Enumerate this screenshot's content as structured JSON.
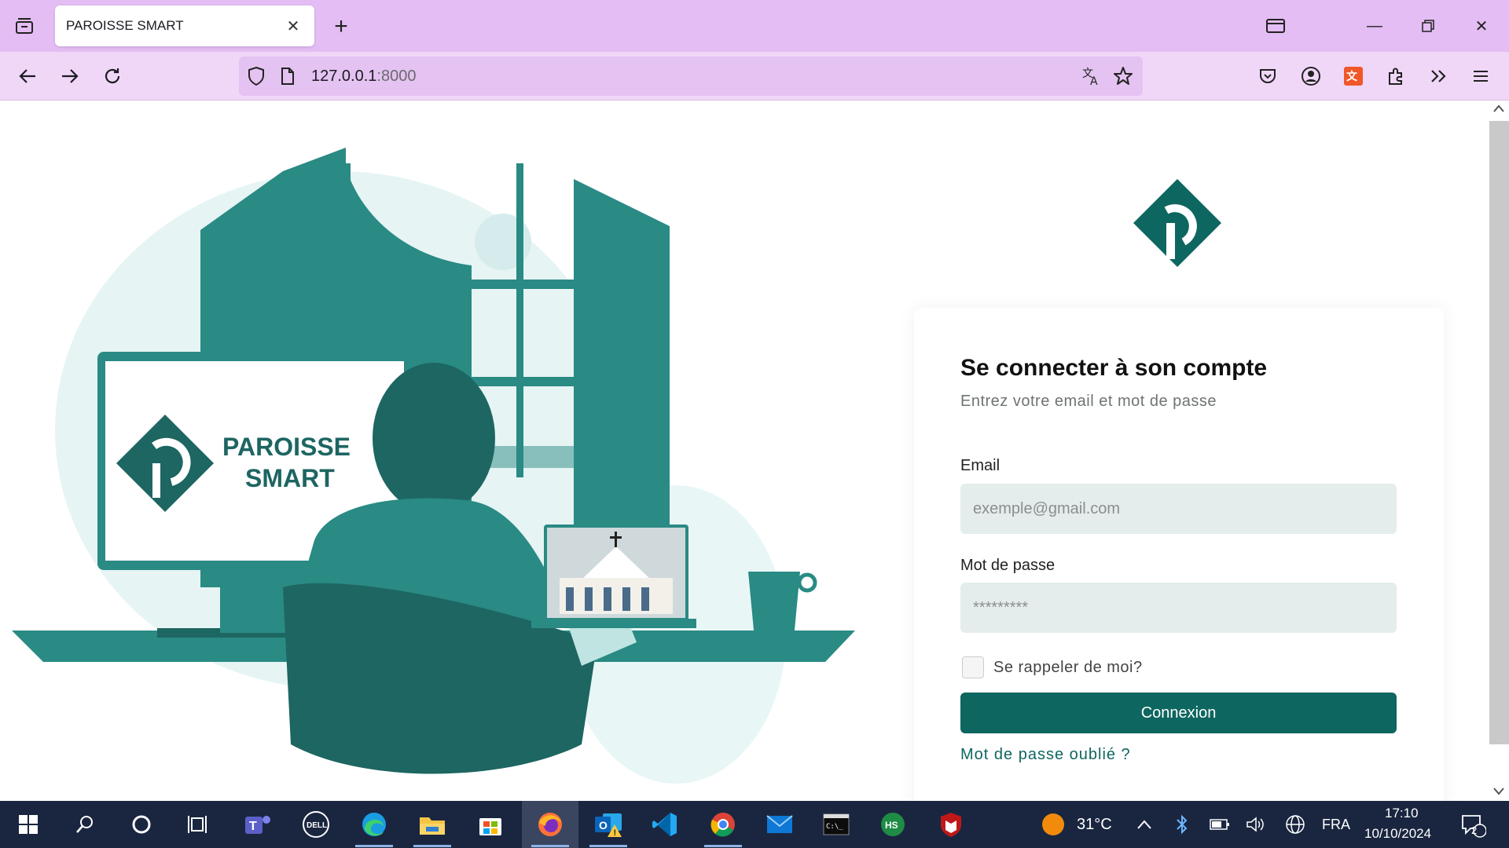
{
  "browser": {
    "tab_title": "PAROISSE SMART",
    "url_host": "127.0.0.1",
    "url_port": ":8000"
  },
  "brand": {
    "monitor_line1": "PAROISSE",
    "monitor_line2": "SMART",
    "color_primary": "#0e6660",
    "color_illustration": "#2a8a84",
    "color_dark": "#1d6662"
  },
  "login": {
    "title": "Se connecter à son compte",
    "subtitle": "Entrez votre email et mot de passe",
    "email_label": "Email",
    "email_placeholder": "exemple@gmail.com",
    "password_label": "Mot de passe",
    "password_placeholder": "*********",
    "remember_label": "Se rappeler de moi?",
    "remember_checked": false,
    "submit_label": "Connexion",
    "forgot_label": "Mot de passe oublié ?"
  },
  "taskbar": {
    "weather_temp": "31°C",
    "language": "FRA",
    "time": "17:10",
    "date": "10/10/2024",
    "notification_count": "2",
    "apps": [
      "start-icon",
      "search-icon",
      "cortana-icon",
      "task-view-icon",
      "teams-icon",
      "dell-icon",
      "edge-icon",
      "file-explorer-icon",
      "store-icon",
      "firefox-icon",
      "outlook-icon",
      "vscode-icon",
      "chrome-icon",
      "mail-icon",
      "terminal-icon",
      "hs-icon",
      "mcafee-icon"
    ]
  }
}
